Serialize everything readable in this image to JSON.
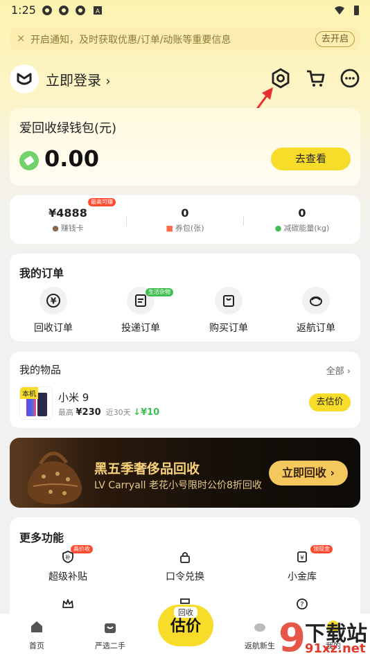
{
  "status_bar": {
    "time": "1:25"
  },
  "notice": {
    "text": "开启通知，及时获取优惠/订单/动账等重要信息",
    "button": "去开启",
    "close_glyph": "×"
  },
  "header": {
    "login": "立即登录"
  },
  "wallet": {
    "title": "爱回收绿钱包(元)",
    "amount": "0.00",
    "button": "去查看"
  },
  "stats": [
    {
      "value": "¥4888",
      "label": "赚钱卡",
      "badge": "最高可赚"
    },
    {
      "value": "0",
      "label": "券包(张)"
    },
    {
      "value": "0",
      "label": "减碳能量(kg)"
    }
  ],
  "orders": {
    "title": "我的订单",
    "items": [
      {
        "label": "回收订单",
        "icon": "yen-circle-icon"
      },
      {
        "label": "投递订单",
        "icon": "delivery-box-icon",
        "badge": "生活杂物"
      },
      {
        "label": "购买订单",
        "icon": "shopping-bag-icon"
      },
      {
        "label": "返航订单",
        "icon": "return-icon"
      }
    ]
  },
  "my_items": {
    "title": "我的物品",
    "all": "全部",
    "phone": {
      "tag": "本机",
      "name": "小米 9",
      "max_label": "最高",
      "price": "¥230",
      "period": "近30天",
      "change": "¥10"
    },
    "button": "去估价"
  },
  "banner": {
    "title": "黑五季奢侈品回收",
    "subtitle": "LV Carryall 老花小号限时公价8折回收",
    "button": "立即回收"
  },
  "more": {
    "title": "更多功能",
    "items": [
      {
        "label": "超级补贴",
        "badge": "高价收"
      },
      {
        "label": "口令兑换"
      },
      {
        "label": "小金库",
        "badge": "领现金"
      }
    ]
  },
  "tabbar": {
    "items": [
      {
        "label": "首页"
      },
      {
        "label": "严选二手"
      },
      {
        "label": "返航新生"
      },
      {
        "label": "我的"
      }
    ],
    "center_small": "回收",
    "center_big": "估价"
  },
  "watermark": {
    "text1": "下载站",
    "text2": "91xz.net"
  },
  "colors": {
    "accent": "#f7dc2a",
    "green": "#3fbf52",
    "red": "#ff4a2e"
  }
}
